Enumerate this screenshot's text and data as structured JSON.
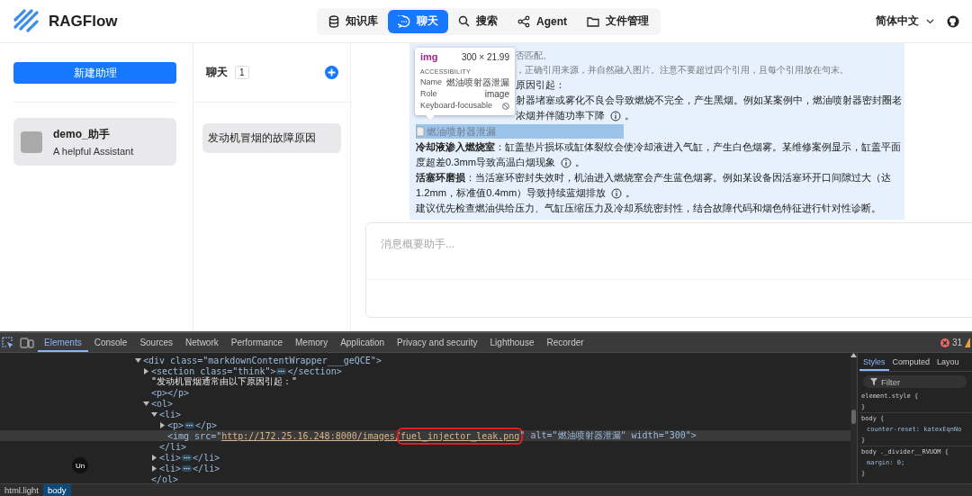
{
  "header": {
    "logo": "RAGFlow",
    "nav": [
      {
        "label": "知识库",
        "selected": false
      },
      {
        "label": "聊天",
        "selected": true
      },
      {
        "label": "搜索",
        "selected": false
      },
      {
        "label": "Agent",
        "selected": false
      },
      {
        "label": "文件管理",
        "selected": false
      }
    ],
    "language": "简体中文"
  },
  "assistants": {
    "new_button": "新建助理",
    "items": [
      {
        "name": "demo_助手",
        "description": "A helpful Assistant",
        "selected": true
      }
    ]
  },
  "conversations": {
    "title": "聊天",
    "count": "1",
    "items": [
      {
        "title": "发动机冒烟的故障原因",
        "selected": true
      }
    ]
  },
  "message": {
    "tooltip": {
      "tag": "img",
      "size": "300 × 21.99",
      "section": "ACCESSIBILITY",
      "rows": [
        {
          "label": "Name",
          "value": "燃油喷射器泄漏"
        },
        {
          "label": "Role",
          "value": "image"
        },
        {
          "label": "Keyboard-focusable",
          "kind": "blocked"
        }
      ]
    },
    "lines": [
      {
        "kind": "think",
        "text": "否匹配。",
        "covered": true
      },
      {
        "kind": "think",
        "text": "，正确引用来源，并自然融入图片。注意不要超过四个引用，且每个引用放在句末。",
        "covered": true
      },
      {
        "kind": "text",
        "text": "原因引起：",
        "covered": true
      },
      {
        "kind": "text",
        "text": "射器堵塞或雾化不良会导致燃烧不完全，产生黑烟。例如某案例中，燃油喷射器密封圈老",
        "covered": true
      },
      {
        "kind": "text",
        "text": "浓烟并伴随功率下降",
        "cite": true,
        "after": "。",
        "covered": true
      },
      {
        "kind": "image",
        "text": "燃油喷射器泄漏"
      },
      {
        "kind": "text",
        "text": "**冷却液渗入燃烧室**：缸盖垫片损坏或缸体裂纹会使冷却液进入气缸，产生白色烟雾。某维修案例显示，缸盖平面"
      },
      {
        "kind": "text",
        "text": "度超差0.3mm导致高温白烟现象",
        "cite": true,
        "after": "。"
      },
      {
        "kind": "text",
        "text": "**活塞环磨损**：当活塞环密封失效时，机油进入燃烧室会产生蓝色烟雾。例如某设备因活塞环开口间隙过大（达"
      },
      {
        "kind": "text",
        "text": "1.2mm，标准值0.4mm）导致持续蓝烟排放",
        "cite": true,
        "after": "。"
      },
      {
        "kind": "text",
        "text": "建议优先检查燃油供给压力、气缸压缩压力及冷却系统密封性，结合故障代码和烟色特征进行针对性诊断。"
      }
    ]
  },
  "input": {
    "placeholder": "消息概要助手..."
  },
  "devtools": {
    "tabs": [
      {
        "label": "Elements",
        "selected": true
      },
      {
        "label": "Console",
        "selected": false
      },
      {
        "label": "Sources",
        "selected": false
      },
      {
        "label": "Network",
        "selected": false
      },
      {
        "label": "Performance",
        "selected": false
      },
      {
        "label": "Memory",
        "selected": false
      },
      {
        "label": "Application",
        "selected": false
      },
      {
        "label": "Privacy and security",
        "selected": false
      },
      {
        "label": "Lighthouse",
        "selected": false
      },
      {
        "label": "Recorder",
        "selected": false
      }
    ],
    "error_count": "31",
    "dom": [
      {
        "open": "<div class=\"markdownContentWrapper___geQCE\">",
        "expanded": true,
        "children": [
          {
            "open": "<section class=\"think\">",
            "close": "</section>",
            "expanded": false
          },
          {
            "text": "\"发动机冒烟通常由以下原因引起：\""
          },
          {
            "text": "<p></p>"
          },
          {
            "open": "<ol>",
            "close": "</ol>",
            "expanded": true,
            "children": [
              {
                "open": "<li>",
                "close": "</li>",
                "expanded": true,
                "children": [
                  {
                    "open": "<p>",
                    "close": "</p>",
                    "expanded": false
                  },
                  {
                    "selected": true,
                    "segments": [
                      {
                        "kind": "plain",
                        "text": "<img src=\""
                      },
                      {
                        "kind": "link",
                        "text": "http://172.25.16.248:8000/images/"
                      },
                      {
                        "kind": "boxed",
                        "text": "fuel_injector_leak.png"
                      },
                      {
                        "kind": "plain",
                        "text": "\" alt=\"燃油喷射器泄漏\" width=\"300\">"
                      }
                    ]
                  }
                ]
              },
              {
                "open": "<li>",
                "close": "</li>",
                "expanded": false
              },
              {
                "open": "<li>",
                "close": "</li>",
                "expanded": false
              }
            ]
          }
        ]
      }
    ],
    "cursor_badge": "Un",
    "styles": {
      "tabs": [
        {
          "label": "Styles",
          "selected": true
        },
        {
          "label": "Computed",
          "selected": false
        },
        {
          "label": "Layou",
          "selected": false
        }
      ],
      "filter_placeholder": "Filter",
      "rules": [
        {
          "kind": "selector",
          "text": "element.style {"
        },
        {
          "kind": "brace",
          "text": "}"
        },
        {
          "kind": "selector",
          "text": "body {"
        },
        {
          "kind": "decl",
          "text": "counter-reset: katexEqnNo"
        },
        {
          "kind": "brace",
          "text": "}"
        },
        {
          "kind": "selector",
          "text": "body ._divider__RVUOM {"
        },
        {
          "kind": "decl",
          "text": "margin: 0;"
        },
        {
          "kind": "brace",
          "text": "}"
        }
      ]
    },
    "breadcrumbs": [
      {
        "label": "html.light",
        "selected": false
      },
      {
        "label": "body",
        "selected": true
      }
    ]
  }
}
